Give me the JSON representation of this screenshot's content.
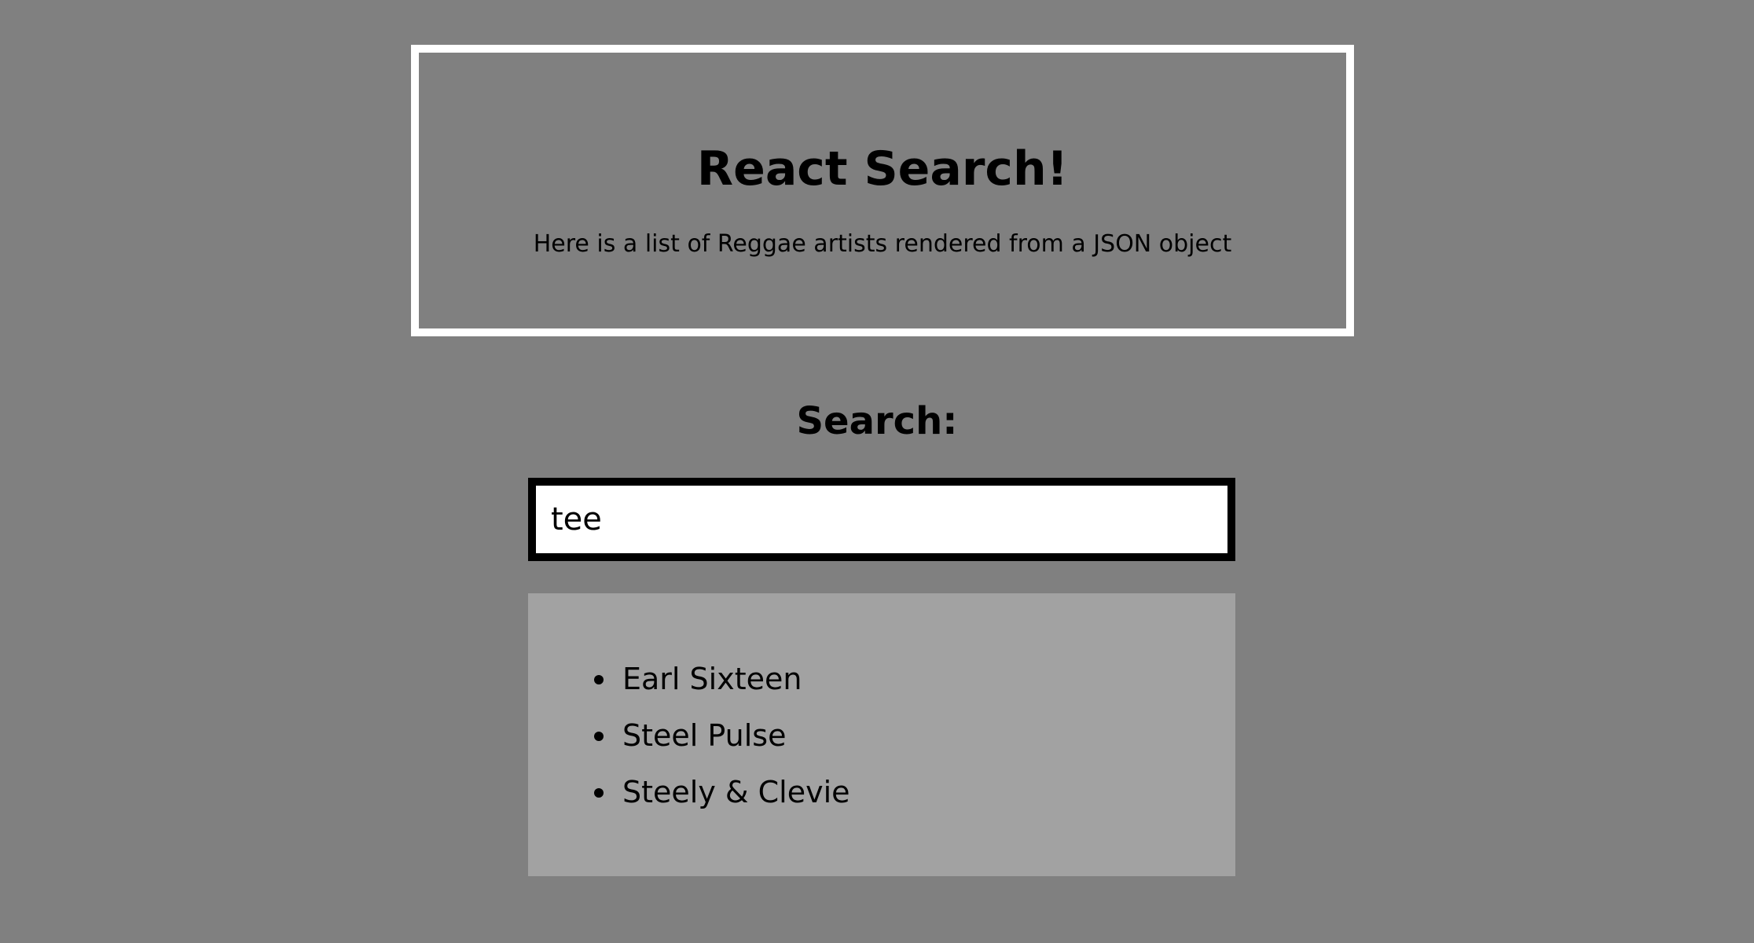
{
  "header": {
    "title": "React Search!",
    "subtitle": "Here is a list of Reggae artists rendered from a JSON object"
  },
  "search": {
    "label": "Search:",
    "value": "tee"
  },
  "results": [
    "Earl Sixteen",
    "Steel Pulse",
    "Steely & Clevie"
  ],
  "colors": {
    "background": "#808080",
    "header_border": "#ffffff",
    "input_border": "#000000",
    "results_background": "#a2a2a2"
  }
}
